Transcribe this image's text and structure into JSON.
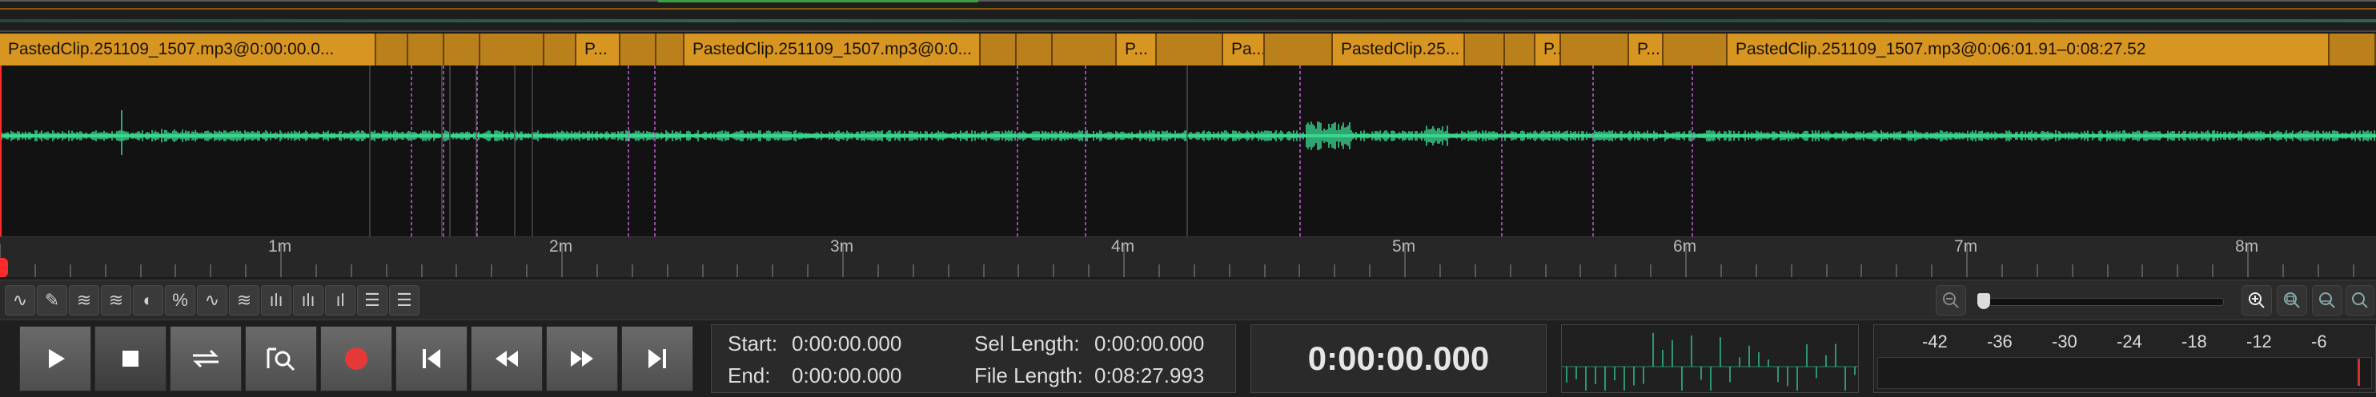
{
  "clips": [
    {
      "label": "PastedClip.251109_1507.mp3@0:00:00.0...",
      "start": 0,
      "end": 470
    },
    {
      "label": "",
      "start": 470,
      "end": 510
    },
    {
      "label": "",
      "start": 510,
      "end": 555
    },
    {
      "label": "",
      "start": 555,
      "end": 600
    },
    {
      "label": "",
      "start": 600,
      "end": 680
    },
    {
      "label": "",
      "start": 680,
      "end": 720
    },
    {
      "label": "P...",
      "start": 720,
      "end": 775
    },
    {
      "label": "",
      "start": 775,
      "end": 820
    },
    {
      "label": "",
      "start": 820,
      "end": 855
    },
    {
      "label": "PastedClip.251109_1507.mp3@0:0...",
      "start": 855,
      "end": 1225
    },
    {
      "label": "",
      "start": 1225,
      "end": 1270
    },
    {
      "label": "",
      "start": 1270,
      "end": 1315
    },
    {
      "label": "",
      "start": 1315,
      "end": 1395
    },
    {
      "label": "P...",
      "start": 1395,
      "end": 1445
    },
    {
      "label": "",
      "start": 1445,
      "end": 1528
    },
    {
      "label": "Pa...",
      "start": 1528,
      "end": 1580
    },
    {
      "label": "",
      "start": 1580,
      "end": 1665
    },
    {
      "label": "PastedClip.25...",
      "start": 1665,
      "end": 1830
    },
    {
      "label": "",
      "start": 1830,
      "end": 1880
    },
    {
      "label": "",
      "start": 1880,
      "end": 1918
    },
    {
      "label": "P...",
      "start": 1918,
      "end": 1950
    },
    {
      "label": "",
      "start": 1950,
      "end": 2035
    },
    {
      "label": "P...",
      "start": 2035,
      "end": 2078
    },
    {
      "label": "",
      "start": 2078,
      "end": 2158
    },
    {
      "label": "PastedClip.251109_1507.mp3@0:06:01.91–0:08:27.52",
      "start": 2158,
      "end": 2910
    },
    {
      "label": "",
      "start": 2910,
      "end": 2968
    }
  ],
  "ruler": {
    "ticks": [
      "1m",
      "2m",
      "3m",
      "4m",
      "5m",
      "6m",
      "7m",
      "8m"
    ]
  },
  "toolbar": {
    "tools": [
      "waveform-icon",
      "pencil-icon",
      "spectral-icon",
      "spectral-frequency-icon",
      "spectral-pan-icon",
      "effect-icon",
      "remove-icon",
      "normalize-icon",
      "waveform-alt-icon",
      "spectrum-icon",
      "bar-spectrum-icon",
      "levels-icon",
      "list-icon"
    ]
  },
  "transport": {
    "buttons": [
      "play",
      "stop",
      "loop",
      "scrub",
      "record",
      "go-to-start",
      "rewind",
      "fast-forward",
      "go-to-end"
    ]
  },
  "selection": {
    "start_label": "Start:",
    "start_value": "0:00:00.000",
    "end_label": "End:",
    "end_value": "0:00:00.000",
    "sel_length_label": "Sel Length:",
    "sel_length_value": "0:00:00.000",
    "file_length_label": "File Length:",
    "file_length_value": "0:08:27.993"
  },
  "time_display": "0:00:00.000",
  "meter": {
    "scale": [
      "-42",
      "-36",
      "-30",
      "-24",
      "-18",
      "-12",
      "-6"
    ]
  },
  "colors": {
    "clip": "#d79621",
    "waveform": "#3bd68f",
    "marker": "#c060d0",
    "playhead": "#ff2a2a"
  }
}
